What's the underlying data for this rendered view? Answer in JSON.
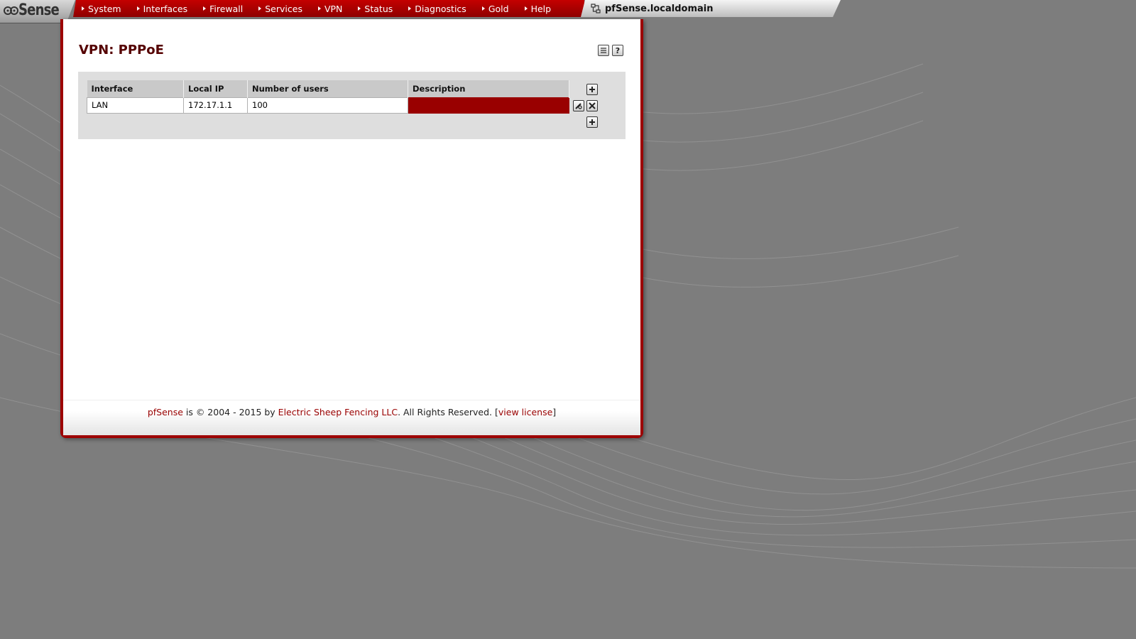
{
  "brand": {
    "logo_text": "Sense"
  },
  "menu": [
    {
      "label": "System"
    },
    {
      "label": "Interfaces"
    },
    {
      "label": "Firewall"
    },
    {
      "label": "Services"
    },
    {
      "label": "VPN"
    },
    {
      "label": "Status"
    },
    {
      "label": "Diagnostics"
    },
    {
      "label": "Gold"
    },
    {
      "label": "Help"
    }
  ],
  "host": {
    "name": "pfSense.localdomain"
  },
  "page": {
    "title": "VPN: PPPoE"
  },
  "table": {
    "headers": [
      "Interface",
      "Local IP",
      "Number of users",
      "Description"
    ],
    "rows": [
      {
        "interface": "LAN",
        "local_ip": "172.17.1.1",
        "users": "100",
        "description": ""
      }
    ]
  },
  "footer": {
    "product": "pfSense",
    "text1": " is © 2004 - 2015 by ",
    "company": "Electric Sheep Fencing LLC",
    "text2": ". All Rights Reserved. [",
    "license_link": "view license",
    "text3": "]"
  },
  "colors": {
    "accent": "#990000",
    "menu_bar": "#b30000",
    "title": "#550000",
    "background": "#7d7d7d"
  },
  "icons": {
    "title_actions": [
      "log-icon",
      "help-icon"
    ],
    "row_actions": [
      "add-icon",
      "edit-icon",
      "delete-icon"
    ]
  }
}
